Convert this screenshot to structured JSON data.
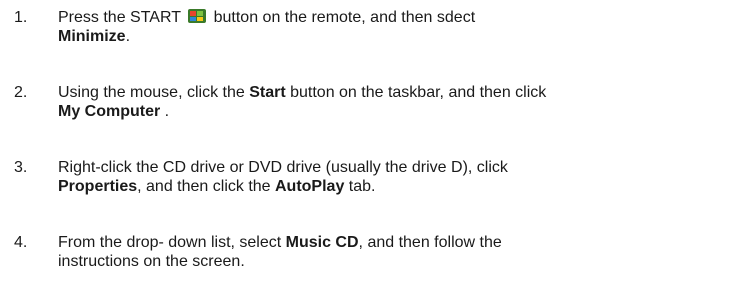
{
  "steps": [
    {
      "number": "1.",
      "line1_a": "Press the START",
      "line1_b": " button on the remote, and then sdect",
      "line2_bold": "Minimize",
      "line2_end": "."
    },
    {
      "number": "2.",
      "line1_a": "Using the mouse, click the ",
      "line1_bold": "Start",
      "line1_b": " button on the taskbar, and then click",
      "line2_bold": "My Computer",
      "line2_end": " ."
    },
    {
      "number": "3.",
      "line1": "Right-click the CD drive or DVD drive (usually the drive D), click",
      "line2_bold1": "Properties",
      "line2_mid": ", and then click the ",
      "line2_bold2": "AutoPlay",
      "line2_end": " tab."
    },
    {
      "number": "4.",
      "line1_a": "From the drop- down list, select ",
      "line1_bold": "Music CD",
      "line1_b": ", and then follow the",
      "line2": "instructions on the screen."
    }
  ],
  "icons": {
    "start_button": "windows-media-center-start-icon"
  }
}
